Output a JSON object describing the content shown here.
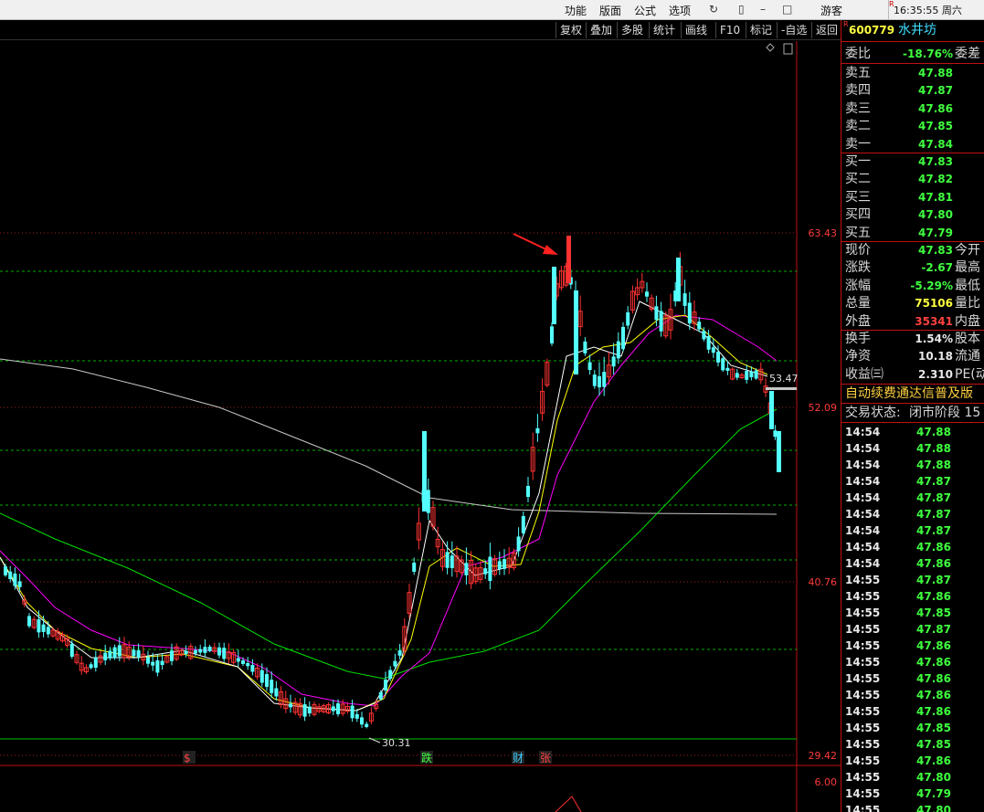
{
  "topbar": {
    "menus": [
      "功能",
      "版面",
      "公式",
      "选项"
    ],
    "guest": "游客",
    "clock": "16:35:55 周六",
    "r_badge": "R"
  },
  "toolbar": {
    "items": [
      "复权",
      "叠加",
      "多股",
      "统计",
      "画线",
      "F10",
      "标记",
      "-自选",
      "返回"
    ]
  },
  "chart": {
    "price_labels": [
      "63.43",
      "52.09",
      "40.76",
      "29.42"
    ],
    "volume_label": "6.00",
    "low_marker": "30.31",
    "current_marker": "53.47",
    "event_tags": [
      {
        "text": "$",
        "color": "#ff4040"
      },
      {
        "text": "跌",
        "color": "#40ff40"
      },
      {
        "text": "财",
        "color": "#40d0ff"
      },
      {
        "text": "张",
        "color": "#ff4040"
      }
    ],
    "colors": {
      "up": "#ff3232",
      "down": "#54ffff",
      "ma5": "#ffffff",
      "ma10": "#ffff00",
      "ma20": "#ff00ff",
      "ma60": "#00e000",
      "ma250": "#c8c8c8",
      "grid": "#00b000",
      "arrow": "#ff2020"
    }
  },
  "stock": {
    "code": "600779",
    "name": "水井坊"
  },
  "order_book": {
    "weibi_label": "委比",
    "weibi": "-18.76%",
    "weicha_label": "委差",
    "asks": [
      {
        "label": "卖五",
        "price": "47.88"
      },
      {
        "label": "卖四",
        "price": "47.87"
      },
      {
        "label": "卖三",
        "price": "47.86"
      },
      {
        "label": "卖二",
        "price": "47.85"
      },
      {
        "label": "卖一",
        "price": "47.84"
      }
    ],
    "bids": [
      {
        "label": "买一",
        "price": "47.83"
      },
      {
        "label": "买二",
        "price": "47.82"
      },
      {
        "label": "买三",
        "price": "47.81"
      },
      {
        "label": "买四",
        "price": "47.80"
      },
      {
        "label": "买五",
        "price": "47.79"
      }
    ]
  },
  "quote": [
    {
      "label": "现价",
      "value": "47.83",
      "color": "#3fff3f",
      "next": "今开"
    },
    {
      "label": "涨跌",
      "value": "-2.67",
      "color": "#3fff3f",
      "next": "最高"
    },
    {
      "label": "涨幅",
      "value": "-5.29%",
      "color": "#3fff3f",
      "next": "最低"
    },
    {
      "label": "总量",
      "value": "75106",
      "color": "#ffff40",
      "next": "量比"
    },
    {
      "label": "外盘",
      "value": "35341",
      "color": "#ff4040",
      "next": "内盘"
    }
  ],
  "stats": [
    {
      "label": "换手",
      "value": "1.54%",
      "next": "股本"
    },
    {
      "label": "净资",
      "value": "10.18",
      "next": "流通"
    },
    {
      "label": "收益㈢",
      "value": "2.310",
      "next": "PE(动"
    }
  ],
  "banner": {
    "ad": "自动续费通达信普及版",
    "status_label": "交易状态:",
    "status_value": "闭市阶段 15"
  },
  "ticks": [
    {
      "time": "14:54",
      "price": "47.88"
    },
    {
      "time": "14:54",
      "price": "47.88"
    },
    {
      "time": "14:54",
      "price": "47.88"
    },
    {
      "time": "14:54",
      "price": "47.87"
    },
    {
      "time": "14:54",
      "price": "47.87"
    },
    {
      "time": "14:54",
      "price": "47.87"
    },
    {
      "time": "14:54",
      "price": "47.87"
    },
    {
      "time": "14:54",
      "price": "47.86"
    },
    {
      "time": "14:54",
      "price": "47.86"
    },
    {
      "time": "14:55",
      "price": "47.87"
    },
    {
      "time": "14:55",
      "price": "47.86"
    },
    {
      "time": "14:55",
      "price": "47.85"
    },
    {
      "time": "14:55",
      "price": "47.87"
    },
    {
      "time": "14:55",
      "price": "47.86"
    },
    {
      "time": "14:55",
      "price": "47.86"
    },
    {
      "time": "14:55",
      "price": "47.86"
    },
    {
      "time": "14:55",
      "price": "47.86"
    },
    {
      "time": "14:55",
      "price": "47.86"
    },
    {
      "time": "14:55",
      "price": "47.85"
    },
    {
      "time": "14:55",
      "price": "47.85"
    },
    {
      "time": "14:55",
      "price": "47.86"
    },
    {
      "time": "14:55",
      "price": "47.80"
    },
    {
      "time": "14:55",
      "price": "47.79"
    },
    {
      "time": "14:55",
      "price": "47.80"
    }
  ]
}
